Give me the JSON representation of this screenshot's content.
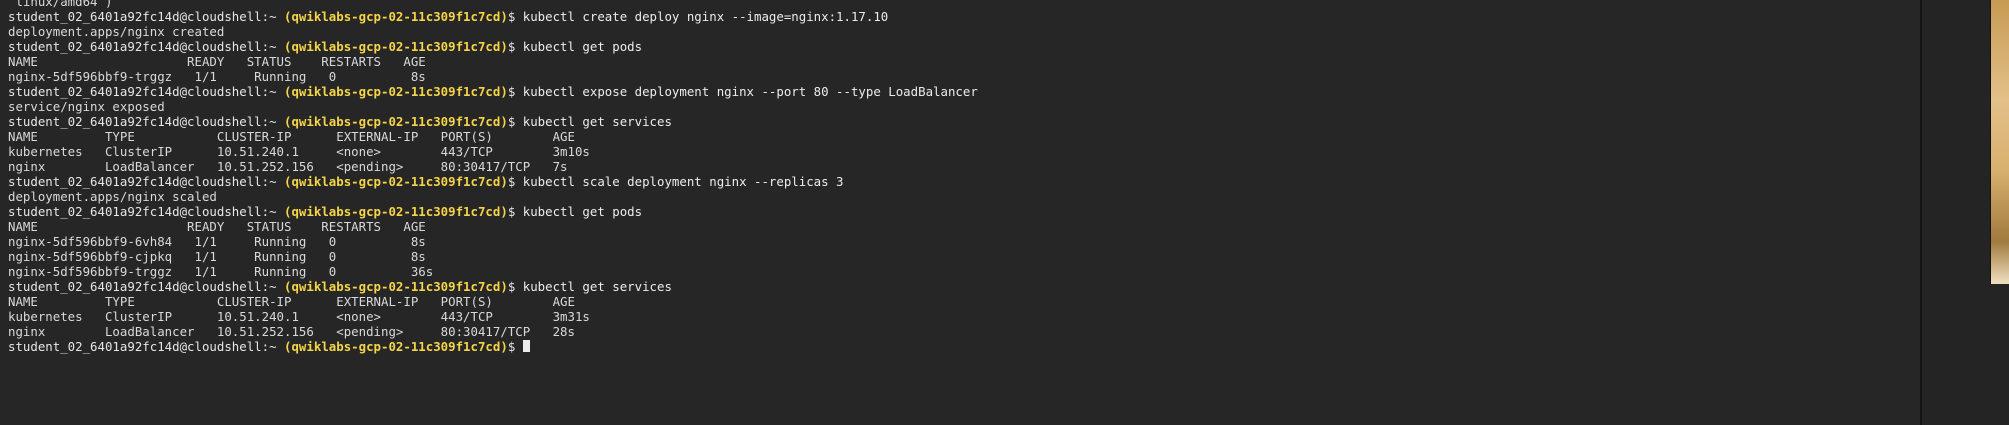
{
  "terminal": {
    "prompt_user": "student_02_6401a92fc14d@cloudshell:~ ",
    "prompt_project": "(qwiklabs-gcp-02-11c309f1c7cd)",
    "prompt_suffix": "$ ",
    "lines": [
      {
        "type": "output",
        "text": " linux/amd64 )"
      },
      {
        "type": "command",
        "cmd": "kubectl create deploy nginx --image=nginx:1.17.10"
      },
      {
        "type": "output",
        "text": "deployment.apps/nginx created"
      },
      {
        "type": "command",
        "cmd": "kubectl get pods"
      },
      {
        "type": "output",
        "text": "NAME                    READY   STATUS    RESTARTS   AGE"
      },
      {
        "type": "output",
        "text": "nginx-5df596bbf9-trggz   1/1     Running   0          8s"
      },
      {
        "type": "command",
        "cmd": "kubectl expose deployment nginx --port 80 --type LoadBalancer"
      },
      {
        "type": "output",
        "text": "service/nginx exposed"
      },
      {
        "type": "command",
        "cmd": "kubectl get services"
      },
      {
        "type": "output",
        "text": "NAME         TYPE           CLUSTER-IP      EXTERNAL-IP   PORT(S)        AGE"
      },
      {
        "type": "output",
        "text": "kubernetes   ClusterIP      10.51.240.1     <none>        443/TCP        3m10s"
      },
      {
        "type": "output",
        "text": "nginx        LoadBalancer   10.51.252.156   <pending>     80:30417/TCP   7s"
      },
      {
        "type": "command",
        "cmd": "kubectl scale deployment nginx --replicas 3"
      },
      {
        "type": "output",
        "text": "deployment.apps/nginx scaled"
      },
      {
        "type": "command",
        "cmd": "kubectl get pods"
      },
      {
        "type": "output",
        "text": "NAME                    READY   STATUS    RESTARTS   AGE"
      },
      {
        "type": "output",
        "text": "nginx-5df596bbf9-6vh84   1/1     Running   0          8s"
      },
      {
        "type": "output",
        "text": "nginx-5df596bbf9-cjpkq   1/1     Running   0          8s"
      },
      {
        "type": "output",
        "text": "nginx-5df596bbf9-trggz   1/1     Running   0          36s"
      },
      {
        "type": "command",
        "cmd": "kubectl get services"
      },
      {
        "type": "output",
        "text": "NAME         TYPE           CLUSTER-IP      EXTERNAL-IP   PORT(S)        AGE"
      },
      {
        "type": "output",
        "text": "kubernetes   ClusterIP      10.51.240.1     <none>        443/TCP        3m31s"
      },
      {
        "type": "output",
        "text": "nginx        LoadBalancer   10.51.252.156   <pending>     80:30417/TCP   28s"
      },
      {
        "type": "prompt",
        "cmd": ""
      }
    ]
  },
  "colors": {
    "background": "#262626",
    "text": "#d9d9d9",
    "project": "#f5d547"
  }
}
